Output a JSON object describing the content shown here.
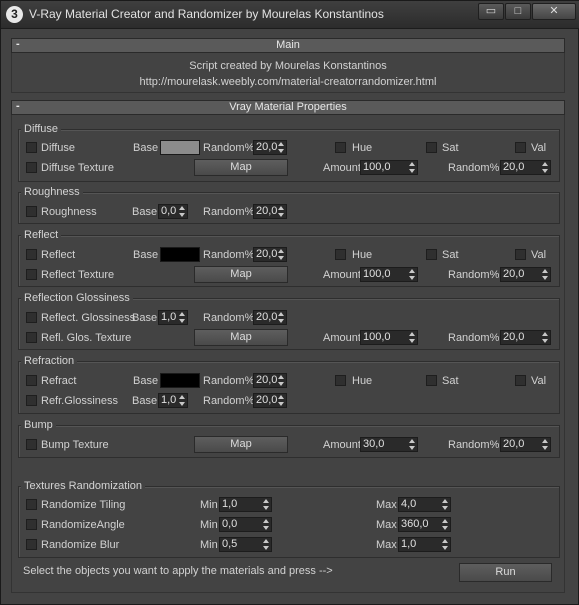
{
  "window": {
    "title": "V-Ray Material Creator and Randomizer by Mourelas Konstantinos",
    "app_icon": "3",
    "controls": {
      "minimize": "▭",
      "maximize": "□",
      "close": "✕"
    }
  },
  "main": {
    "header": "Main",
    "collapse": "-",
    "credit": "Script created by Mourelas Konstantinos",
    "url": "http://mourelask.weebly.com/material-creatorrandomizer.html"
  },
  "props": {
    "header": "Vray Material Properties",
    "collapse": "-",
    "diffuse": {
      "title": "Diffuse",
      "check_label": "Diffuse",
      "base_label": "Base",
      "base_color": "#8c8c8c",
      "random_label": "Random%",
      "random_value": "20,0",
      "hue": "Hue",
      "sat": "Sat",
      "val": "Val",
      "texture_label": "Diffuse Texture",
      "map_button": "Map",
      "amount_label": "Amount",
      "amount_value": "100,0",
      "tex_random_label": "Random%",
      "tex_random_value": "20,0"
    },
    "roughness": {
      "title": "Roughness",
      "check_label": "Roughness",
      "base_label": "Base",
      "base_value": "0,0",
      "random_label": "Random%",
      "random_value": "20,0"
    },
    "reflect": {
      "title": "Reflect",
      "check_label": "Reflect",
      "base_label": "Base",
      "base_color": "#000000",
      "random_label": "Random%",
      "random_value": "20,0",
      "hue": "Hue",
      "sat": "Sat",
      "val": "Val",
      "texture_label": "Reflect Texture",
      "map_button": "Map",
      "amount_label": "Amount",
      "amount_value": "100,0",
      "tex_random_label": "Random%",
      "tex_random_value": "20,0"
    },
    "reflection_glossiness": {
      "title": "Reflection Glossiness",
      "check_label": "Reflect. Glossiness",
      "base_label": "Base",
      "base_value": "1,0",
      "random_label": "Random%",
      "random_value": "20,0",
      "texture_label": "Refl. Glos. Texture",
      "map_button": "Map",
      "amount_label": "Amount",
      "amount_value": "100,0",
      "tex_random_label": "Random%",
      "tex_random_value": "20,0"
    },
    "refraction": {
      "title": "Refraction",
      "check_label": "Refract",
      "base_label": "Base",
      "base_color": "#000000",
      "random_label": "Random%",
      "random_value": "20,0",
      "hue": "Hue",
      "sat": "Sat",
      "val": "Val",
      "gloss_label": "Refr.Glossiness",
      "gloss_base_label": "Base",
      "gloss_base_value": "1,0",
      "gloss_random_label": "Random%",
      "gloss_random_value": "20,0"
    },
    "bump": {
      "title": "Bump",
      "texture_label": "Bump Texture",
      "map_button": "Map",
      "amount_label": "Amount",
      "amount_value": "30,0",
      "random_label": "Random%",
      "random_value": "20,0"
    },
    "textures_randomization": {
      "title": "Textures Randomization",
      "tiling": {
        "label": "Randomize Tiling",
        "min_label": "Min",
        "min": "1,0",
        "max_label": "Max",
        "max": "4,0"
      },
      "angle": {
        "label": "RandomizeAngle",
        "min_label": "Min",
        "min": "0,0",
        "max_label": "Max",
        "max": "360,0"
      },
      "blur": {
        "label": "Randomize Blur",
        "min_label": "Min",
        "min": "0,5",
        "max_label": "Max",
        "max": "1,0"
      }
    },
    "footer_text": "Select the objects you want to apply the materials and press -->",
    "run_button": "Run"
  }
}
